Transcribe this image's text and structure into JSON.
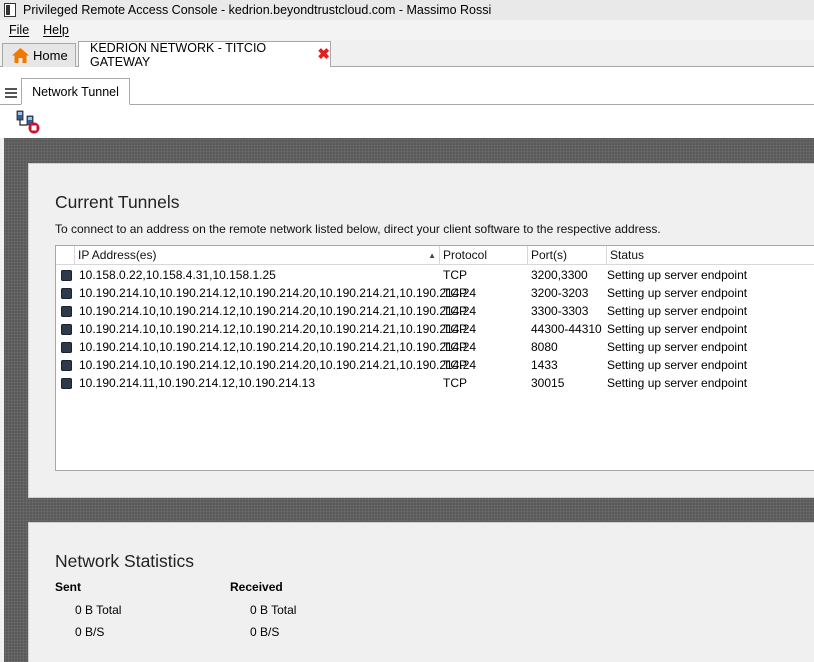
{
  "window": {
    "title": "Privileged Remote Access Console - kedrion.beyondtrustcloud.com - Massimo Rossi"
  },
  "menu": {
    "file": "File",
    "help": "Help"
  },
  "tabs": {
    "home_label": "Home",
    "active_label": "KEDRION NETWORK - TITCIO GATEWAY",
    "close_glyph": "✖"
  },
  "subtabs": {
    "network_tunnel": "Network Tunnel"
  },
  "tunnels": {
    "heading": "Current Tunnels",
    "description": "To connect to an address on the remote network listed below, direct your client software to the respective address.",
    "columns": {
      "ip": "IP Address(es)",
      "protocol": "Protocol",
      "ports": "Port(s)",
      "status": "Status"
    },
    "rows": [
      {
        "ip": "10.158.0.22,10.158.4.31,10.158.1.25",
        "protocol": "TCP",
        "ports": "3200,3300",
        "status": "Setting up server endpoint"
      },
      {
        "ip": "10.190.214.10,10.190.214.12,10.190.214.20,10.190.214.21,10.190.214.24",
        "protocol": "TCP",
        "ports": "3200-3203",
        "status": "Setting up server endpoint"
      },
      {
        "ip": "10.190.214.10,10.190.214.12,10.190.214.20,10.190.214.21,10.190.214.24",
        "protocol": "TCP",
        "ports": "3300-3303",
        "status": "Setting up server endpoint"
      },
      {
        "ip": "10.190.214.10,10.190.214.12,10.190.214.20,10.190.214.21,10.190.214.24",
        "protocol": "TCP",
        "ports": "44300-44310",
        "status": "Setting up server endpoint"
      },
      {
        "ip": "10.190.214.10,10.190.214.12,10.190.214.20,10.190.214.21,10.190.214.24",
        "protocol": "TCP",
        "ports": "8080",
        "status": "Setting up server endpoint"
      },
      {
        "ip": "10.190.214.10,10.190.214.12,10.190.214.20,10.190.214.21,10.190.214.24",
        "protocol": "TCP",
        "ports": "1433",
        "status": "Setting up server endpoint"
      },
      {
        "ip": "10.190.214.11,10.190.214.12,10.190.214.13",
        "protocol": "TCP",
        "ports": "30015",
        "status": "Setting up server endpoint"
      }
    ]
  },
  "stats": {
    "heading": "Network Statistics",
    "sent_label": "Sent",
    "received_label": "Received",
    "sent_total": "0 B Total",
    "sent_rate": "0 B/S",
    "received_total": "0 B Total",
    "received_rate": "0 B/S"
  },
  "colors": {
    "close_red": "#e02020",
    "home_orange": "#f07800",
    "toolbar_red": "#d0102a"
  },
  "icons": {
    "app": "app-window-icon",
    "home": "home-icon",
    "menu": "hamburger-icon",
    "tool": "stop-tunnel-icon",
    "row": "tunnel-row-icon"
  }
}
